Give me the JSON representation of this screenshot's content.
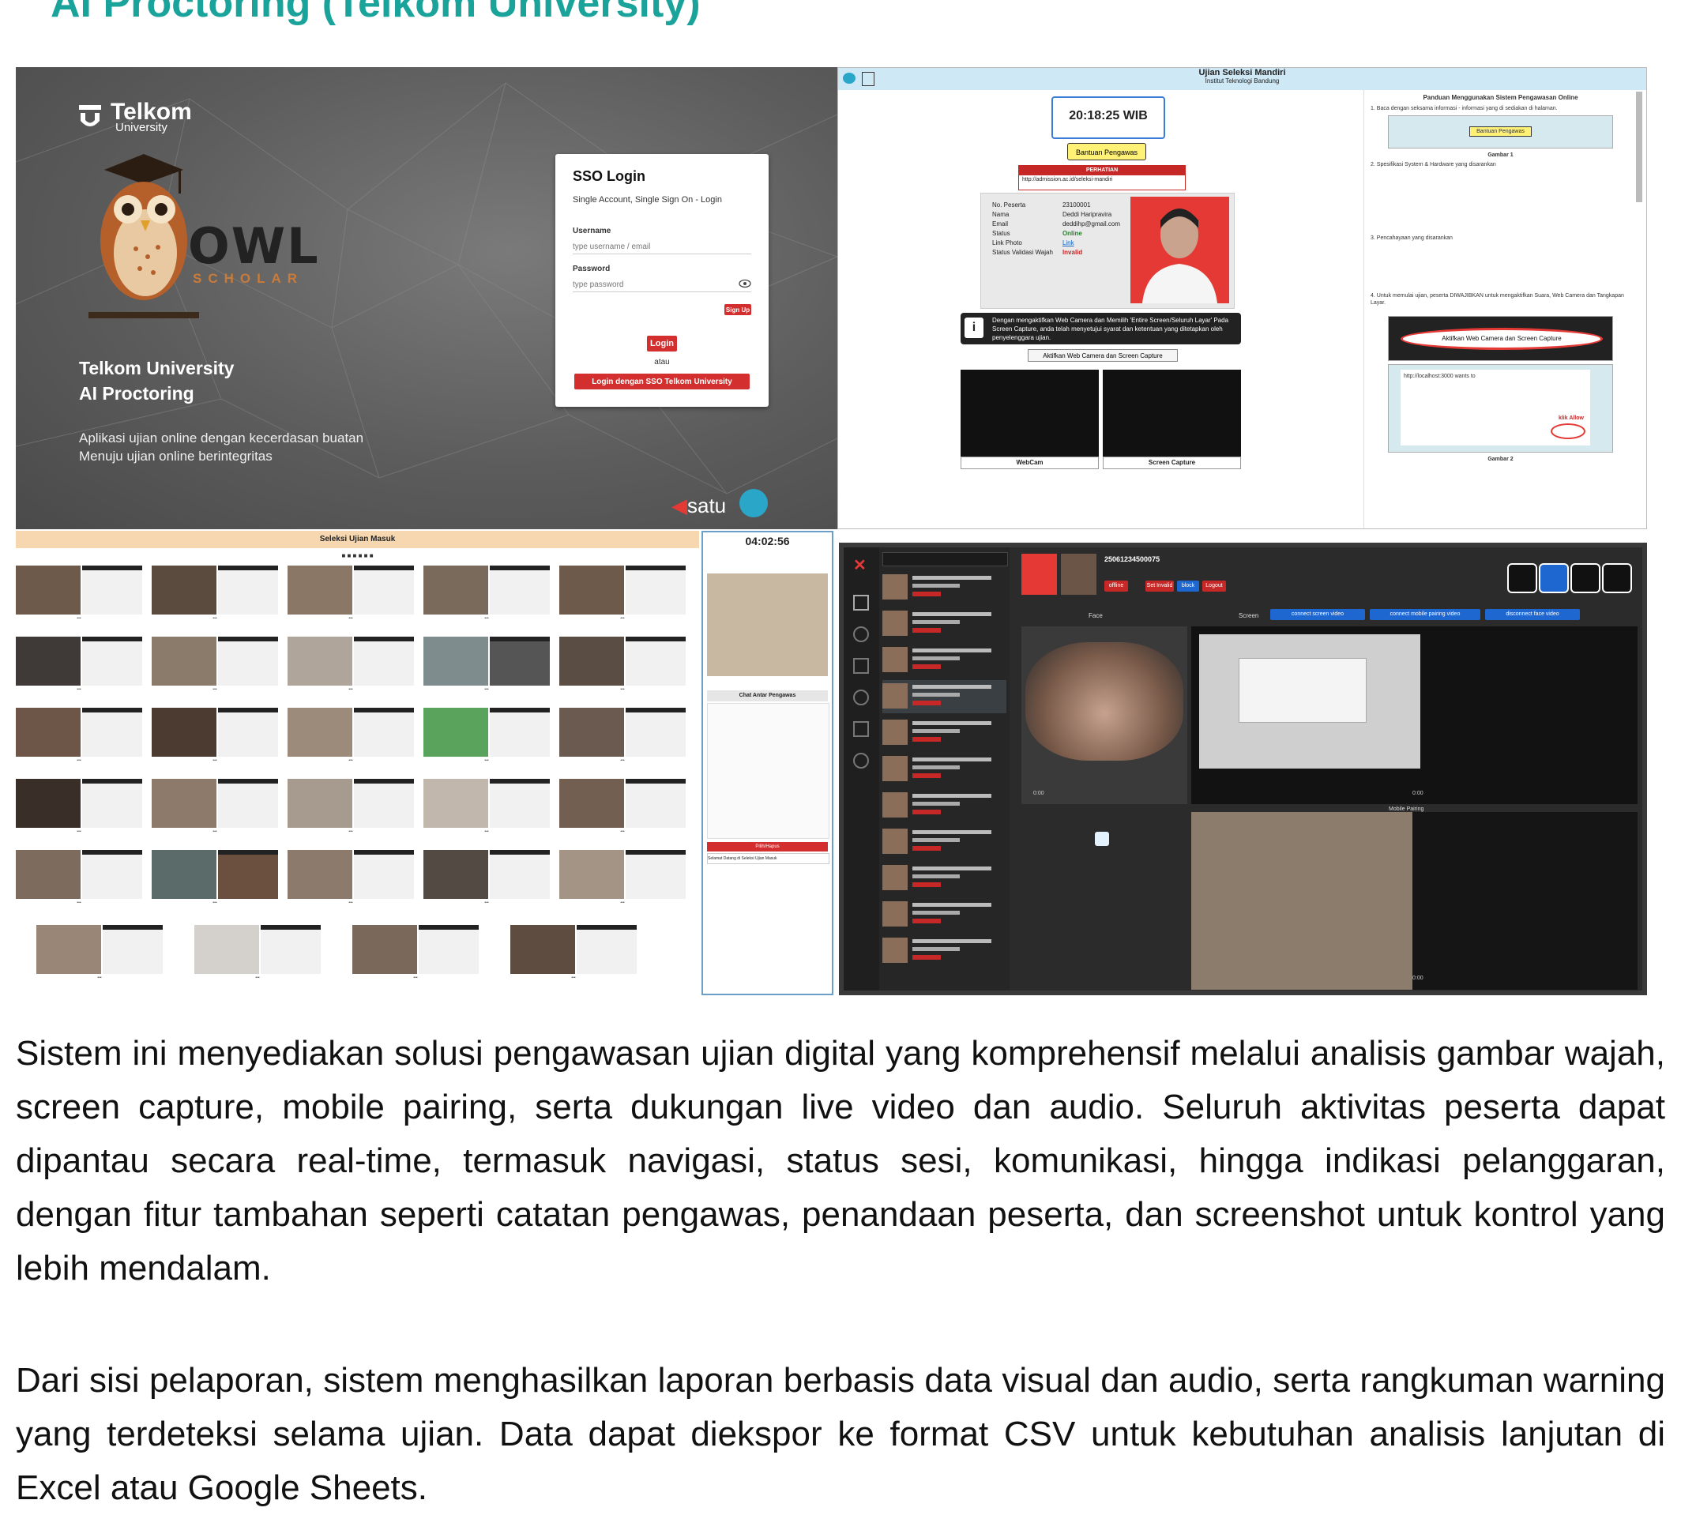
{
  "page": {
    "title": "AI Proctoring (Telkom University)"
  },
  "panel_login": {
    "logo_text": "Telkom",
    "logo_sub": "University",
    "owl_word": "OWL",
    "owl_sub": "SCHOLAR",
    "heading_line1": "Telkom University",
    "heading_line2": "AI Proctoring",
    "desc_line1": "Aplikasi ujian online dengan kecerdasan buatan",
    "desc_line2": "Menuju ujian online berintegritas",
    "card": {
      "title": "SSO Login",
      "subtitle": "Single Account, Single Sign On - Login",
      "username_label": "Username",
      "username_placeholder": "type username / email",
      "password_label": "Password",
      "password_placeholder": "type password",
      "signup": "Sign Up",
      "login": "Login",
      "or": "atau",
      "sso_button": "Login dengan SSO Telkom University"
    },
    "footer_brand": "satu"
  },
  "panel_exam": {
    "header_title": "Ujian Seleksi Mandiri",
    "header_sub": "Institut Teknologi Bandung",
    "clock": "20:18:25 WIB",
    "help_button": "Bantuan Pengawas",
    "notice_title": "PERHATIAN",
    "notice_url": "http://admission.ac.id/seleksi-mandiri",
    "fields": [
      {
        "k": "No. Peserta",
        "v": "23100001"
      },
      {
        "k": "Nama",
        "v": "Deddi Haripravira"
      },
      {
        "k": "Email",
        "v": "deddihp@gmail.com"
      },
      {
        "k": "Status",
        "v": "Online"
      },
      {
        "k": "Link Photo",
        "v": "Link"
      },
      {
        "k": "Status Validasi Wajah",
        "v": "Invalid"
      }
    ],
    "consent_text": "Dengan mengaktifkan Web Camera dan Memilih 'Entire Screen/Seluruh Layar' Pada Screen Capture, anda telah menyetujui syarat dan ketentuan yang ditetapkan oleh penyelenggara ujian.",
    "activate_button": "Aktifkan Web Camera dan Screen Capture",
    "webcam_label": "WebCam",
    "screen_label": "Screen Capture",
    "guide_title": "Panduan Menggunakan Sistem Pengawasan Online",
    "guide_image_caption": "Aktifkan Web Camera dan Screen Capture",
    "guide_gambar1": "Gambar 1",
    "guide_gambar2": "Gambar 2",
    "guide_allow": "klik Allow",
    "guide_dialog": "http://localhost:3000 wants to"
  },
  "panel_grid": {
    "header_title": "Seleksi Ujian Masuk",
    "timer": "04:02:56",
    "chat_title": "Chat Antar Pengawas",
    "red_button": "Pilih/Hapus",
    "welcome": "Selamat Datang di Seleksi Ujian Masuk"
  },
  "panel_monitor": {
    "participant_id": "25061234500075",
    "status_pills": [
      "offline",
      "Set Invalid",
      "block",
      "Logout"
    ],
    "face_label": "Face",
    "screen_label": "Screen",
    "screen_buttons": [
      "connect screen video",
      "connect mobile pairing video",
      "disconnect face video"
    ],
    "mobile_label": "Mobile Pairing",
    "time_code": "0:00"
  },
  "paragraphs": [
    "Sistem ini menyediakan solusi pengawasan ujian digital yang komprehensif melalui analisis gambar wajah, screen capture, mobile pairing, serta dukungan live video dan audio. Seluruh aktivitas peserta dapat dipantau secara real-time, termasuk navigasi, status sesi, komunikasi, hingga indikasi pelanggaran, dengan fitur tambahan seperti catatan pengawas, penandaan peserta, dan screenshot untuk kontrol yang lebih mendalam.",
    "Dari sisi pelaporan, sistem menghasilkan laporan berbasis data visual dan audio, serta rangkuman warning yang terdeteksi selama ujian. Data dapat diekspor ke format CSV untuk kebutuhan analisis lanjutan di Excel atau Google Sheets."
  ],
  "colors": {
    "title_teal": "#1aa39a",
    "accent_red": "#d32f2f"
  }
}
